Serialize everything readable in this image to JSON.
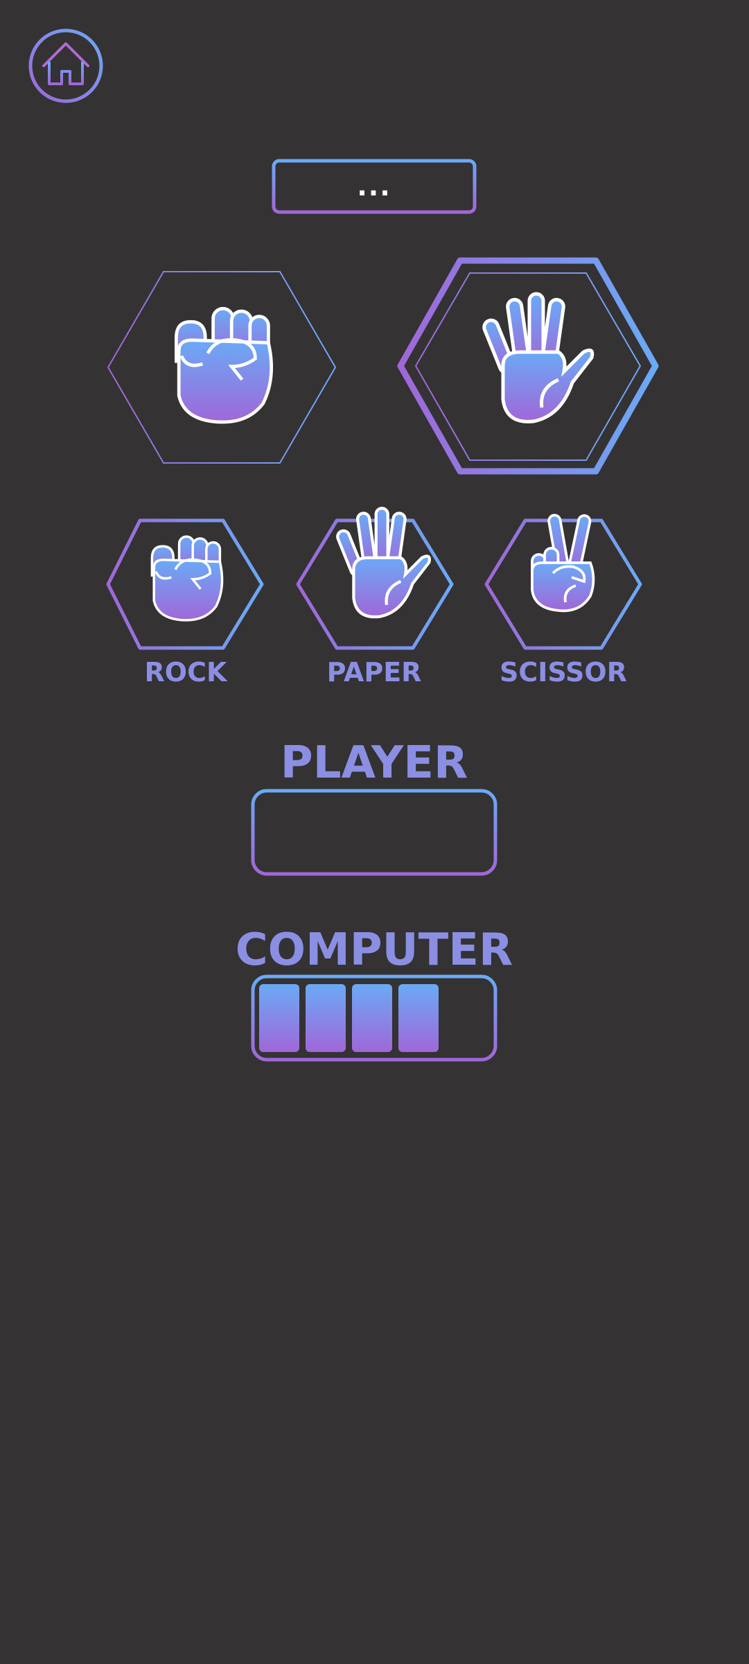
{
  "header": {
    "home_icon": "home-icon",
    "status_text": "..."
  },
  "arena": {
    "player_choice_icon": "fist-icon",
    "computer_choice_icon": "open-hand-icon",
    "computer_highlighted": true
  },
  "choices": [
    {
      "label": "ROCK",
      "icon": "fist-icon"
    },
    {
      "label": "PAPER",
      "icon": "open-hand-icon"
    },
    {
      "label": "SCISSOR",
      "icon": "peace-hand-icon"
    }
  ],
  "scores": {
    "player_label": "PLAYER",
    "player_points": 0,
    "computer_label": "COMPUTER",
    "computer_points": 4,
    "max_points": 5
  },
  "colors": {
    "background": "#343233",
    "gradient_blue": "#6aaaf6",
    "gradient_purple": "#a067d8",
    "label": "#8b8fe3"
  }
}
